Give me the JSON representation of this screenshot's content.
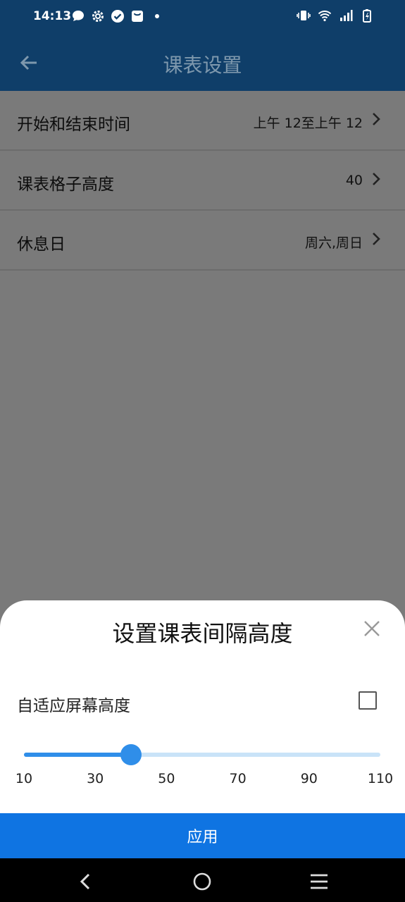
{
  "status_bar": {
    "time": "14:13",
    "left_icons": [
      "chat-bubble-icon",
      "gear-icon",
      "check-circle-icon",
      "bag-icon",
      "dot-icon"
    ],
    "right_icons": [
      "vibrate-icon",
      "wifi-icon",
      "signal-icon",
      "battery-charging-icon"
    ]
  },
  "app_bar": {
    "title": "课表设置",
    "back_icon": "arrow-left-icon"
  },
  "settings_list": [
    {
      "label": "开始和结束时间",
      "value": "上午 12至上午 12"
    },
    {
      "label": "课表格子高度",
      "value": "40"
    },
    {
      "label": "休息日",
      "value": "周六,周日"
    }
  ],
  "sheet": {
    "title": "设置课表间隔高度",
    "auto_fit_label": "自适应屏幕高度",
    "auto_fit_checked": false,
    "slider": {
      "min": 10,
      "max": 110,
      "value": 40,
      "ticks": [
        "10",
        "30",
        "50",
        "70",
        "90",
        "110"
      ]
    },
    "apply_label": "应用"
  },
  "colors": {
    "app_bar": "#0f3e69",
    "accent": "#2f8ee9",
    "apply_button": "#0f74e2",
    "scrim": "#7a7a7a"
  },
  "nav_bar": {
    "icons": [
      "nav-back-icon",
      "nav-home-icon",
      "nav-recents-icon"
    ]
  }
}
